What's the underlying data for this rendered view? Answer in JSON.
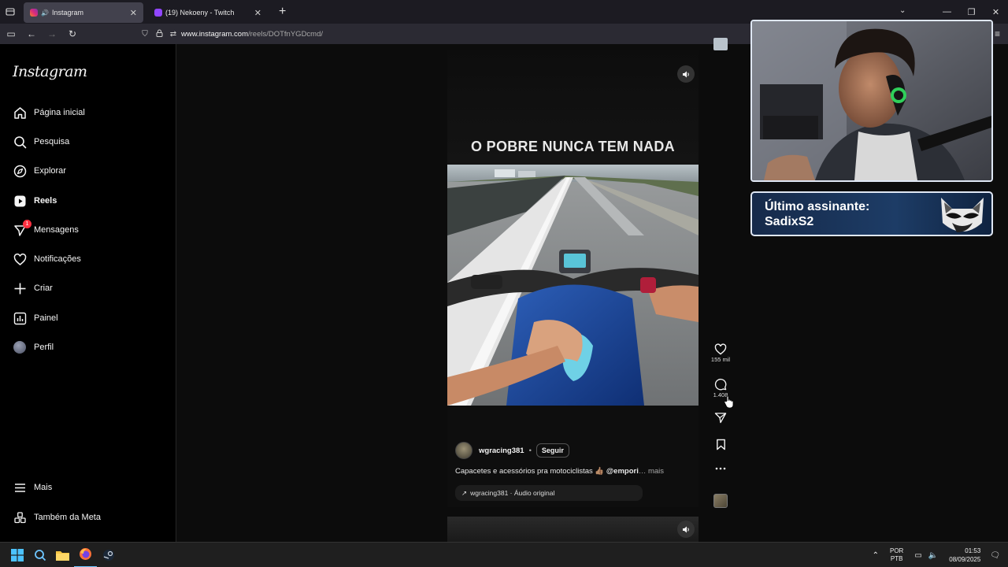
{
  "browser": {
    "tabs": [
      {
        "title": "Instagram",
        "active": true
      },
      {
        "title": "(19) Nekoeny - Twitch",
        "active": false
      }
    ],
    "new_tab": "+",
    "url_host": "www.instagram.com",
    "url_path": "/reels/DOTfnYGDcmd/"
  },
  "sidebar": {
    "logo": "Instagram",
    "items": [
      {
        "label": "Página inicial",
        "icon": "home-icon"
      },
      {
        "label": "Pesquisa",
        "icon": "search-icon"
      },
      {
        "label": "Explorar",
        "icon": "compass-icon"
      },
      {
        "label": "Reels",
        "icon": "reels-icon"
      },
      {
        "label": "Mensagens",
        "icon": "messenger-icon",
        "badge": "1"
      },
      {
        "label": "Notificações",
        "icon": "heart-icon"
      },
      {
        "label": "Criar",
        "icon": "plus-icon"
      },
      {
        "label": "Painel",
        "icon": "dashboard-icon"
      },
      {
        "label": "Perfil",
        "icon": "avatar"
      }
    ],
    "bottom_items": [
      {
        "label": "Mais",
        "icon": "menu-icon"
      },
      {
        "label": "Também da Meta",
        "icon": "meta-icon"
      }
    ]
  },
  "reel": {
    "overlay_text": "O POBRE NUNCA TEM NADA",
    "author": "wgracing381",
    "separator": "•",
    "follow_label": "Seguir",
    "description": "Capacetes e acessórios pra motociclistas 👍🏽",
    "mention": "@empori",
    "more": "… mais",
    "audio": "wgracing381 · Áudio original",
    "likes": "155 mil",
    "comments": "1.408"
  },
  "overlay": {
    "sub_label": "Último assinante:",
    "sub_name": "SadixS2"
  },
  "taskbar": {
    "lang_top": "POR",
    "lang_bottom": "PTB",
    "time": "01:53",
    "date": "08/09/2025"
  },
  "colors": {
    "instagram_bg": "#000000",
    "badge_red": "#ff3040",
    "overlay_blue": "#1d3c66"
  }
}
